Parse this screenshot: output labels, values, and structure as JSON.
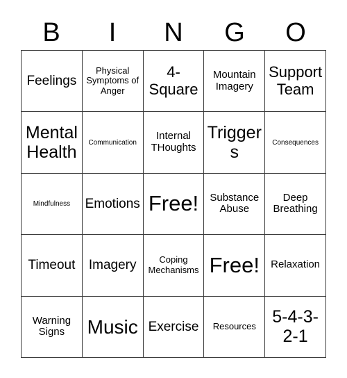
{
  "card": {
    "title": "BINGO Card",
    "header_letters": [
      "B",
      "I",
      "N",
      "G",
      "O"
    ],
    "grid_columns": 5,
    "grid_rows": 5,
    "colors": {
      "background": "#ffffff",
      "text": "#000000",
      "grid_line": "#3c3c3c"
    },
    "cells": [
      {
        "text": "Feelings",
        "size": "sm",
        "column": "B",
        "row": 1,
        "free": false
      },
      {
        "text": "Physical Symptoms of Anger",
        "size": "xxs",
        "column": "I",
        "row": 1,
        "free": false
      },
      {
        "text": "4-Square",
        "size": "md",
        "column": "N",
        "row": 1,
        "free": false
      },
      {
        "text": "Mountain Imagery",
        "size": "xs",
        "column": "G",
        "row": 1,
        "free": false
      },
      {
        "text": "Support Team",
        "size": "md",
        "column": "O",
        "row": 1,
        "free": false
      },
      {
        "text": "Mental Health",
        "size": "lg",
        "column": "B",
        "row": 2,
        "free": false
      },
      {
        "text": "Communication",
        "size": "tiny",
        "column": "I",
        "row": 2,
        "free": false
      },
      {
        "text": "Internal THoughts",
        "size": "xs",
        "column": "N",
        "row": 2,
        "free": false
      },
      {
        "text": "Triggers",
        "size": "lg",
        "column": "G",
        "row": 2,
        "free": false
      },
      {
        "text": "Consequences",
        "size": "tiny",
        "column": "O",
        "row": 2,
        "free": false
      },
      {
        "text": "Mindfulness",
        "size": "tiny",
        "column": "B",
        "row": 3,
        "free": false
      },
      {
        "text": "Emotions",
        "size": "sm",
        "column": "I",
        "row": 3,
        "free": false
      },
      {
        "text": "Free!",
        "size": "xxl",
        "column": "N",
        "row": 3,
        "free": true
      },
      {
        "text": "Substance Abuse",
        "size": "xs",
        "column": "G",
        "row": 3,
        "free": false
      },
      {
        "text": "Deep Breathing",
        "size": "xs",
        "column": "O",
        "row": 3,
        "free": false
      },
      {
        "text": "Timeout",
        "size": "sm",
        "column": "B",
        "row": 4,
        "free": false
      },
      {
        "text": "Imagery",
        "size": "sm",
        "column": "I",
        "row": 4,
        "free": false
      },
      {
        "text": "Coping Mechanisms",
        "size": "xxs",
        "column": "N",
        "row": 4,
        "free": false
      },
      {
        "text": "Free!",
        "size": "xxl",
        "column": "G",
        "row": 4,
        "free": true
      },
      {
        "text": "Relaxation",
        "size": "xs",
        "column": "O",
        "row": 4,
        "free": false
      },
      {
        "text": "Warning Signs",
        "size": "xs",
        "column": "B",
        "row": 5,
        "free": false
      },
      {
        "text": "Music",
        "size": "xl",
        "column": "I",
        "row": 5,
        "free": false
      },
      {
        "text": "Exercise",
        "size": "sm",
        "column": "N",
        "row": 5,
        "free": false
      },
      {
        "text": "Resources",
        "size": "xxs",
        "column": "G",
        "row": 5,
        "free": false
      },
      {
        "text": "5-4-3-2-1",
        "size": "lg",
        "column": "O",
        "row": 5,
        "free": false
      }
    ]
  }
}
